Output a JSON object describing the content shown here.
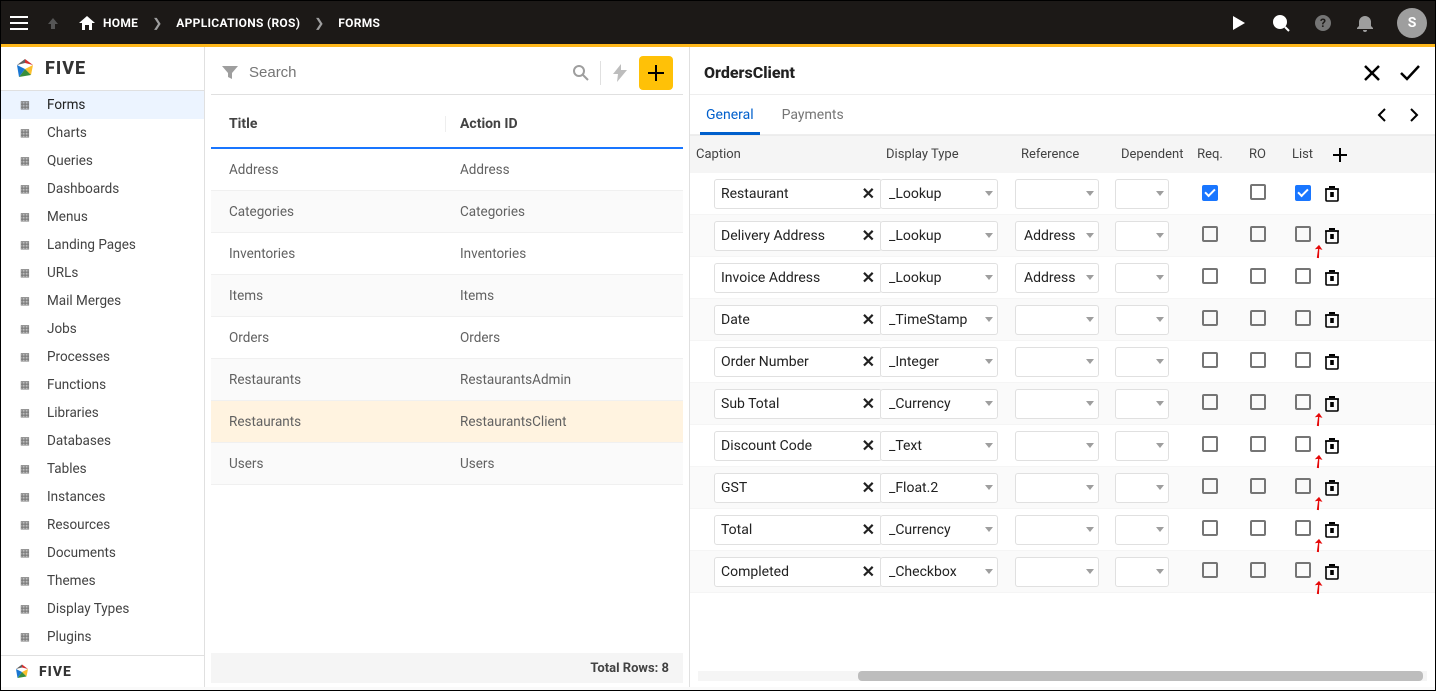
{
  "topbar": {
    "crumbs": [
      {
        "label": "HOME",
        "icon": "home"
      },
      {
        "label": "APPLICATIONS (ROS)"
      },
      {
        "label": "FORMS"
      }
    ],
    "avatar_letter": "S"
  },
  "sidebar": {
    "brand": "FIVE",
    "items": [
      {
        "label": "Forms",
        "selected": true
      },
      {
        "label": "Charts"
      },
      {
        "label": "Queries"
      },
      {
        "label": "Dashboards"
      },
      {
        "label": "Menus"
      },
      {
        "label": "Landing Pages"
      },
      {
        "label": "URLs"
      },
      {
        "label": "Mail Merges"
      },
      {
        "label": "Jobs"
      },
      {
        "label": "Processes"
      },
      {
        "label": "Functions"
      },
      {
        "label": "Libraries"
      },
      {
        "label": "Databases"
      },
      {
        "label": "Tables"
      },
      {
        "label": "Instances"
      },
      {
        "label": "Resources"
      },
      {
        "label": "Documents"
      },
      {
        "label": "Themes"
      },
      {
        "label": "Display Types"
      },
      {
        "label": "Plugins"
      }
    ]
  },
  "list": {
    "search_placeholder": "Search",
    "title_header": "Title",
    "action_header": "Action ID",
    "total_label": "Total Rows: 8",
    "rows": [
      {
        "title": "Address",
        "action": "Address"
      },
      {
        "title": "Categories",
        "action": "Categories"
      },
      {
        "title": "Inventories",
        "action": "Inventories"
      },
      {
        "title": "Items",
        "action": "Items"
      },
      {
        "title": "Orders",
        "action": "Orders"
      },
      {
        "title": "Restaurants",
        "action": "RestaurantsAdmin"
      },
      {
        "title": "Restaurants",
        "action": "RestaurantsClient",
        "highlight": true
      },
      {
        "title": "Users",
        "action": "Users"
      }
    ]
  },
  "detail": {
    "title": "OrdersClient",
    "tabs": [
      {
        "label": "General",
        "active": true
      },
      {
        "label": "Payments"
      }
    ],
    "columns": {
      "caption": "Caption",
      "display": "Display Type",
      "reference": "Reference",
      "dependent": "Dependent",
      "req": "Req.",
      "ro": "RO",
      "list": "List"
    },
    "rows": [
      {
        "caption": "Restaurant",
        "display": "_Lookup",
        "reference": "",
        "req": true,
        "ro": false,
        "list": true,
        "arrow": false
      },
      {
        "caption": "Delivery Address",
        "display": "_Lookup",
        "reference": "Address",
        "req": false,
        "ro": false,
        "list": false,
        "arrow": true
      },
      {
        "caption": "Invoice Address",
        "display": "_Lookup",
        "reference": "Address",
        "req": false,
        "ro": false,
        "list": false,
        "arrow": false
      },
      {
        "caption": "Date",
        "display": "_TimeStamp",
        "reference": "",
        "req": false,
        "ro": false,
        "list": false,
        "arrow": false
      },
      {
        "caption": "Order Number",
        "display": "_Integer",
        "reference": "",
        "req": false,
        "ro": false,
        "list": false,
        "arrow": false
      },
      {
        "caption": "Sub Total",
        "display": "_Currency",
        "reference": "",
        "req": false,
        "ro": false,
        "list": false,
        "arrow": true
      },
      {
        "caption": "Discount Code",
        "display": "_Text",
        "reference": "",
        "req": false,
        "ro": false,
        "list": false,
        "arrow": true
      },
      {
        "caption": "GST",
        "display": "_Float.2",
        "reference": "",
        "req": false,
        "ro": false,
        "list": false,
        "arrow": true
      },
      {
        "caption": "Total",
        "display": "_Currency",
        "reference": "",
        "req": false,
        "ro": false,
        "list": false,
        "arrow": true
      },
      {
        "caption": "Completed",
        "display": "_Checkbox",
        "reference": "",
        "req": false,
        "ro": false,
        "list": false,
        "arrow": true
      }
    ]
  }
}
